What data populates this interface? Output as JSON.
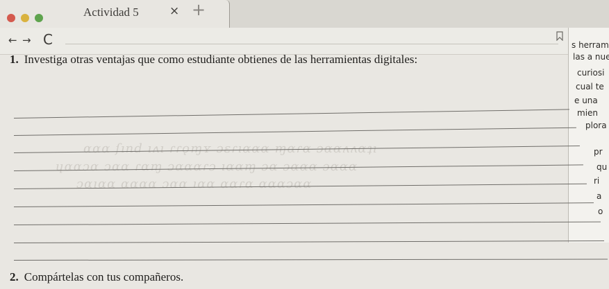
{
  "browser": {
    "tab_title": "Actividad 5",
    "close_glyph": "×",
    "new_tab_glyph": "+",
    "back_glyph": "←",
    "forward_glyph": "→",
    "reload_glyph": "C",
    "window_dots": [
      "#d45a4e",
      "#d9b23e",
      "#5ea34d"
    ]
  },
  "worksheet": {
    "question1_number": "1.",
    "question1_text": "Investiga otras ventajas que como estudiante obtienes de las herramientas digitales:",
    "question2_number": "2.",
    "question2_text": "Compártelas con tus compañeros.",
    "answer_lines": 9
  },
  "side_page": {
    "fragments": [
      "s herram",
      "las a nue",
      "curiosi",
      "cual te",
      "e una",
      "mien",
      "plora",
      "pr",
      "qu",
      "ri",
      "a",
      "o"
    ]
  }
}
